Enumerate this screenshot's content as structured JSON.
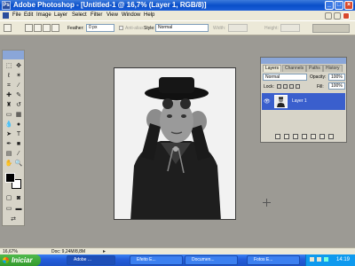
{
  "window": {
    "app_icon_text": "Ps",
    "title": "Adobe Photoshop - [Untitled-1 @ 16,7% (Layer 1, RGB/8)]"
  },
  "menu": [
    "File",
    "Edit",
    "Image",
    "Layer",
    "Select",
    "Filter",
    "View",
    "Window",
    "Help"
  ],
  "options": {
    "feather_label": "Feather:",
    "feather_value": "0 px",
    "antialias_label": "Anti-alias",
    "style_label": "Style:",
    "style_value": "Normal",
    "width_label": "Width:",
    "height_label": "Height:"
  },
  "layers_panel": {
    "tabs": [
      "Layers",
      "Channels",
      "Paths",
      "History"
    ],
    "blend_mode": "Normal",
    "opacity_label": "Opacity:",
    "opacity_value": "100%",
    "lock_label": "Lock:",
    "fill_label": "Fill:",
    "fill_value": "100%",
    "layer_name": "Layer 1"
  },
  "status": {
    "zoom": "16,67%",
    "doc": "Doc: 9,24M/8,8M"
  },
  "taskbar": {
    "start_label": "Iniciar",
    "items": [
      "Adobe ...",
      "Efeito E...",
      "Documen...",
      "Fotos E..."
    ],
    "clock": "14:19"
  },
  "colors": {
    "titlebar": "#0a4fc9",
    "taskbar": "#245edb",
    "start_button": "#329a2c",
    "layer_selected": "#3a5fcd",
    "workspace": "#9c9a94"
  }
}
